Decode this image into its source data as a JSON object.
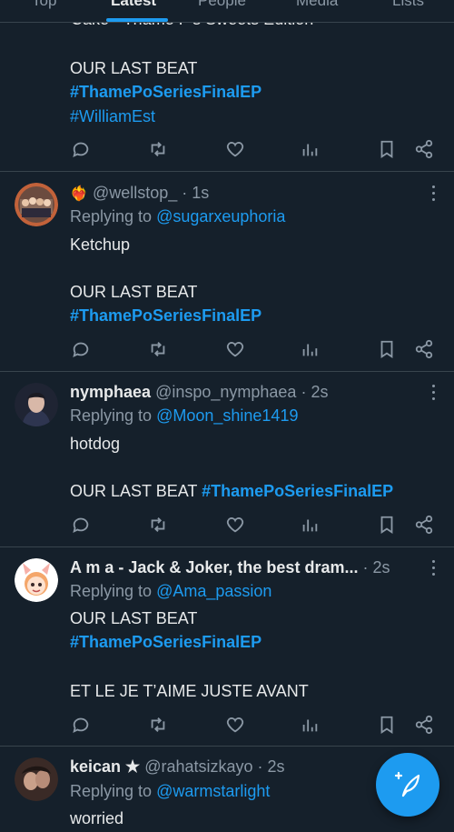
{
  "tabs": [
    {
      "label": "Top",
      "active": false
    },
    {
      "label": "Latest",
      "active": true
    },
    {
      "label": "People",
      "active": false
    },
    {
      "label": "Media",
      "active": false
    },
    {
      "label": "Lists",
      "active": false
    }
  ],
  "prev_tweet": {
    "clipped_line": "Cake - Thame P's Sweets Edition",
    "lines": [
      "OUR LAST BEAT"
    ],
    "hashtags": [
      "#ThamePoSeriesFinalEP",
      "#WilliamEst"
    ]
  },
  "tweets": [
    {
      "display_name": "",
      "name_emoji": "❤️‍🔥",
      "handle": "@wellstop_",
      "time": "· 1s",
      "replying_label": "Replying to",
      "reply_to": "@sugarxeuphoria",
      "body_line1": "Ketchup",
      "body_line2": "OUR LAST BEAT",
      "hashtag": "#ThamePoSeriesFinalEP"
    },
    {
      "display_name": "nymphaea",
      "handle": "@inspo_nymphaea",
      "time": "· 2s",
      "replying_label": "Replying to",
      "reply_to": "@Moon_shine1419",
      "body_line1": "hotdog",
      "body_line2": "OUR LAST BEAT",
      "hashtag": "#ThamePoSeriesFinalEP"
    },
    {
      "display_name": "A m a - Jack & Joker, the best dram...",
      "handle": "",
      "time": "· 2s",
      "replying_label": "Replying to",
      "reply_to": "@Ama_passion",
      "body_line1": "OUR LAST BEAT",
      "hashtag": "#ThamePoSeriesFinalEP",
      "body_line3": "ET LE JE T’AIME JUSTE AVANT"
    },
    {
      "display_name": "keican ★",
      "handle": "@rahatsizkayo",
      "time": "· 2s",
      "replying_label": "Replying to",
      "reply_to": "@warmstarlight",
      "body_line1": "worried"
    }
  ],
  "icons": {
    "reply": "speech-bubble-icon",
    "retweet": "retweet-arrows-icon",
    "like": "heart-icon",
    "views": "bar-chart-icon",
    "bookmark": "bookmark-icon",
    "share": "share-icon",
    "more": "more-dots-icon",
    "compose": "compose-feather-icon"
  },
  "colors": {
    "background": "#15202b",
    "accent": "#1d9bf0",
    "muted": "#8b98a5",
    "divider": "#38444d"
  }
}
